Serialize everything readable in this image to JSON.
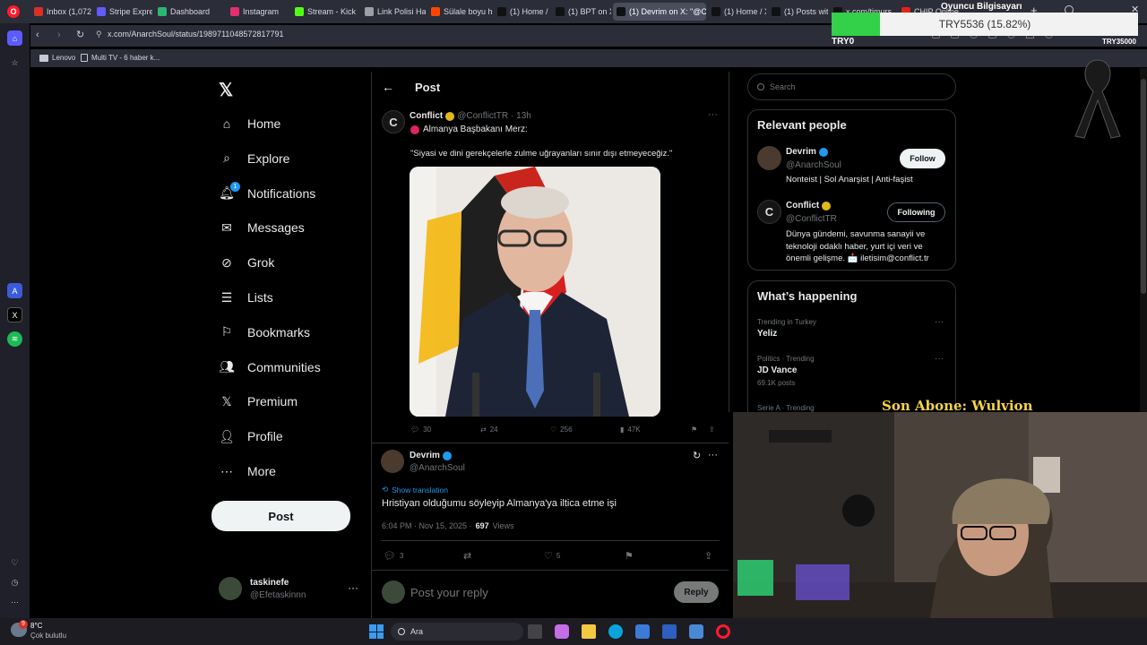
{
  "browser": {
    "tabs": [
      {
        "label": "Inbox (1,072)",
        "icon": "gmail-icon",
        "color": "#d93025"
      },
      {
        "label": "Stripe Express",
        "icon": "stripe-icon",
        "color": "#635bff"
      },
      {
        "label": "Dashboard",
        "icon": "dashboard-icon",
        "color": "#2bb673"
      },
      {
        "label": "Instagram",
        "icon": "instagram-icon",
        "color": "#e1306c"
      },
      {
        "label": "Stream - Kick",
        "icon": "kick-icon",
        "color": "#53fc18"
      },
      {
        "label": "Link Polisi Hal",
        "icon": "link-icon",
        "color": "#9aa0a6"
      },
      {
        "label": "Sülale boyu h",
        "icon": "reddit-icon",
        "color": "#ff4500"
      },
      {
        "label": "(1) Home / X",
        "icon": "x-icon",
        "color": "#000000"
      },
      {
        "label": "(1) BPT on X:",
        "icon": "x-icon",
        "color": "#000000"
      },
      {
        "label": "(1) Devrim on X: \"@Co",
        "icon": "x-icon",
        "color": "#000000"
      },
      {
        "label": "(1) Home / X",
        "icon": "x-icon",
        "color": "#000000"
      },
      {
        "label": "(1) Posts with",
        "icon": "x-icon",
        "color": "#000000"
      },
      {
        "label": "x.com/timurs",
        "icon": "x-icon",
        "color": "#000000"
      },
      {
        "label": "CHIP Online",
        "icon": "chip-icon",
        "color": "#e2231a"
      }
    ],
    "url": "x.com/AnarchSoul/status/1989711048572817791",
    "bookmarks": [
      {
        "label": "Lenovo",
        "icon": "folder-icon"
      },
      {
        "label": "Multi TV - 6 haber k...",
        "icon": "page-icon"
      }
    ]
  },
  "overlay": {
    "goal_title": "Oyuncu Bilgisayarı",
    "goal_progress": "TRY5536 (15.82%)",
    "goal_fraction": 0.1582,
    "goal_start": "TRY0",
    "goal_end": "TRY35000",
    "last_sub": "Son Abone: Wulvion"
  },
  "sidebar": {
    "items": [
      {
        "label": "Home",
        "icon": "home-icon"
      },
      {
        "label": "Explore",
        "icon": "search-icon"
      },
      {
        "label": "Notifications",
        "icon": "bell-icon",
        "badge": "1"
      },
      {
        "label": "Messages",
        "icon": "mail-icon"
      },
      {
        "label": "Grok",
        "icon": "grok-icon"
      },
      {
        "label": "Lists",
        "icon": "list-icon"
      },
      {
        "label": "Bookmarks",
        "icon": "bookmark-icon"
      },
      {
        "label": "Communities",
        "icon": "people-icon"
      },
      {
        "label": "Premium",
        "icon": "x-logo-icon"
      },
      {
        "label": "Profile",
        "icon": "person-icon"
      },
      {
        "label": "More",
        "icon": "more-circle-icon"
      }
    ],
    "post_button": "Post",
    "account": {
      "name": "taskinefe",
      "handle": "@Efetaskinnn"
    }
  },
  "header": {
    "title": "Post"
  },
  "quoted_post": {
    "author": "Conflict",
    "handle": "@ConflictTR",
    "time": "· 13h",
    "line1": "Almanya Başbakanı Merz:",
    "line2": "\"Siyasi ve dini gerekçelerle zulme uğrayanları sınır dışı etmeyeceğiz.\"",
    "replies": "30",
    "reposts": "24",
    "likes": "256",
    "views": "47K"
  },
  "reply_post": {
    "author": "Devrim",
    "handle": "@AnarchSoul",
    "translate": "Show translation",
    "text": "Hristiyan olduğumu söyleyip Almanya'ya iltica etme işi",
    "date": "6:04 PM · Nov 15, 2025 ·",
    "views": "697",
    "views_label": "Views",
    "replies": "3",
    "likes": "5"
  },
  "composer": {
    "placeholder": "Post your reply",
    "button": "Reply"
  },
  "right": {
    "search_placeholder": "Search",
    "relevant_title": "Relevant people",
    "people": [
      {
        "name": "Devrim",
        "handle": "@AnarchSoul",
        "bio": "Nonteist | Sol Anarşist | Anti-faşist",
        "button": "Follow"
      },
      {
        "name": "Conflict",
        "handle": "@ConflictTR",
        "bio": "Dünya gündemi, savunma sanayii ve teknoloji odaklı haber, yurt içi veri ve önemli gelişme. 📩 iletisim@conflict.tr",
        "button": "Following"
      }
    ],
    "happening_title": "What’s happening",
    "trends": [
      {
        "context": "Trending in Turkey",
        "name": "Yeliz",
        "count": ""
      },
      {
        "context": "Politics · Trending",
        "name": "JD Vance",
        "count": "69.1K posts"
      },
      {
        "context": "Serie A · Trending",
        "name": "",
        "count": ""
      }
    ]
  },
  "taskbar": {
    "temp": "8°C",
    "weather": "Çok bulutlu",
    "weather_badge": "9",
    "search": "Ara"
  }
}
